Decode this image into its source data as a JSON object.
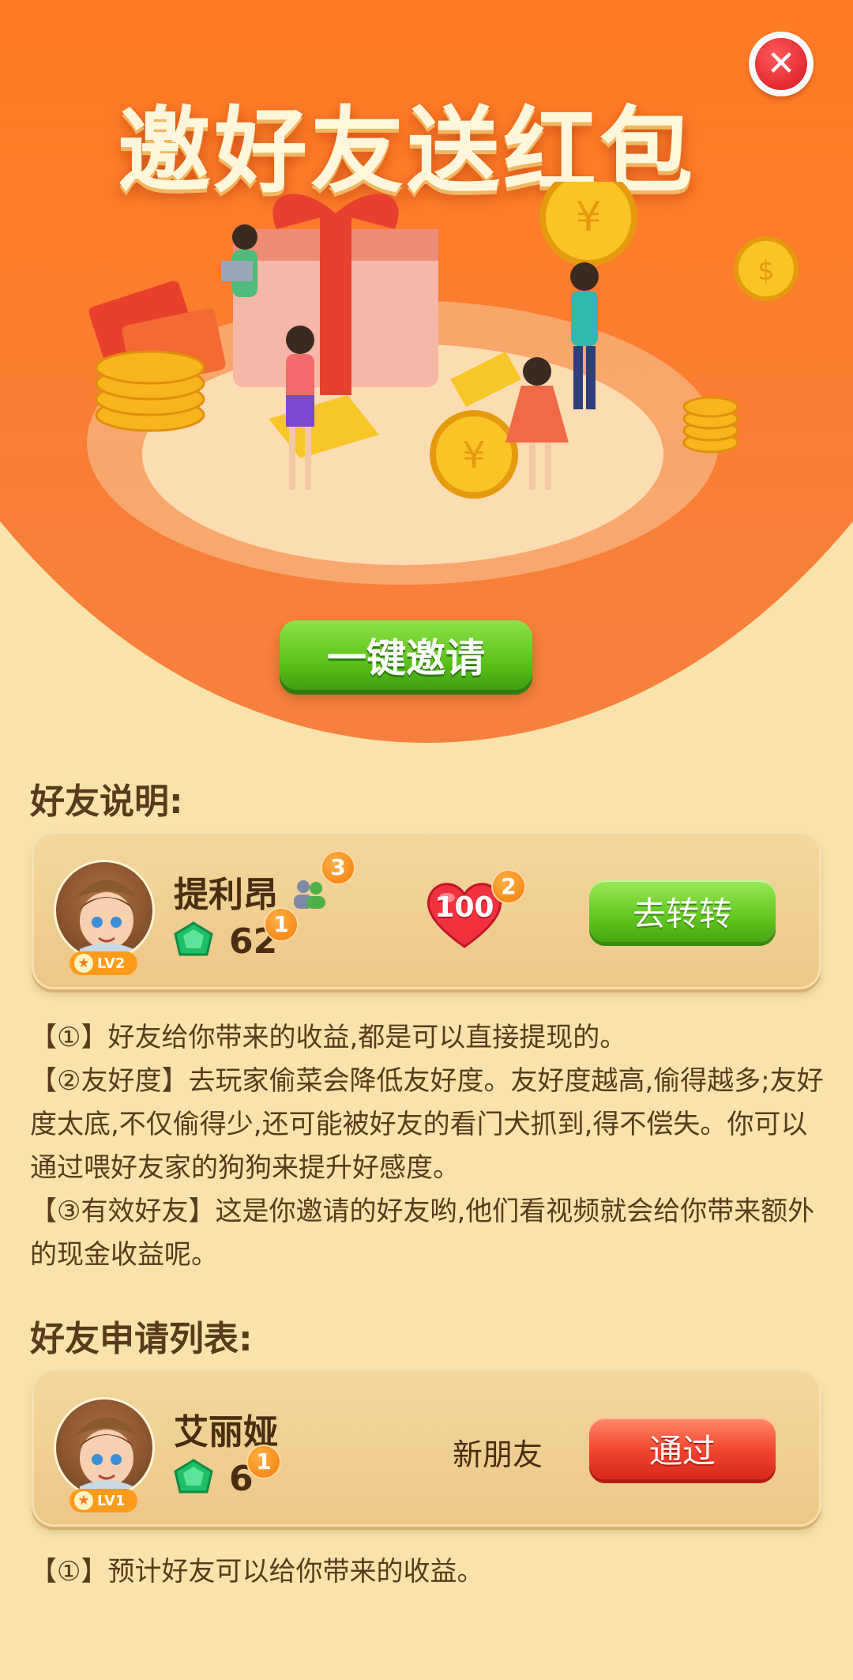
{
  "header": {
    "title": "邀好友送红包",
    "close_icon": "close-icon",
    "invite_button": "一键邀请"
  },
  "friends_section": {
    "title": "好友说明:",
    "friend": {
      "name": "提利昂",
      "level": "LV2",
      "gems": "62",
      "gem_badge": "1",
      "people_badge": "3",
      "affinity": "100",
      "affinity_badge": "2",
      "action": "去转转"
    },
    "notes": [
      "【①】好友给你带来的收益,都是可以直接提现的。",
      "【②友好度】去玩家偷菜会降低友好度。友好度越高,偷得越多;友好度太底,不仅偷得少,还可能被好友的看门犬抓到,得不偿失。你可以通过喂好友家的狗狗来提升好感度。",
      "【③有效好友】这是你邀请的好友哟,他们看视频就会给你带来额外的现金收益呢。"
    ]
  },
  "requests_section": {
    "title": "好友申请列表:",
    "request": {
      "name": "艾丽娅",
      "level": "LV1",
      "gems": "6",
      "gem_badge": "1",
      "status": "新朋友",
      "action": "通过"
    },
    "note": "【①】预计好友可以给你带来的收益。"
  },
  "colors": {
    "header_orange": "#ff6a0c",
    "background": "#f9e3ad",
    "green_button": "#62c61f",
    "red_button": "#f0432d"
  }
}
